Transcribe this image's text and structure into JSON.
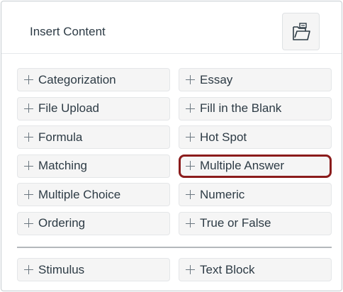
{
  "panel": {
    "title": "Insert Content",
    "folder_icon": "folder-open-icon"
  },
  "items": [
    {
      "label": "Categorization"
    },
    {
      "label": "Essay"
    },
    {
      "label": "File Upload"
    },
    {
      "label": "Fill in the Blank"
    },
    {
      "label": "Formula"
    },
    {
      "label": "Hot Spot"
    },
    {
      "label": "Matching"
    },
    {
      "label": "Multiple Answer",
      "highlighted": true
    },
    {
      "label": "Multiple Choice"
    },
    {
      "label": "Numeric"
    },
    {
      "label": "Ordering"
    },
    {
      "label": "True or False"
    }
  ],
  "extra_items": [
    {
      "label": "Stimulus"
    },
    {
      "label": "Text Block"
    }
  ],
  "colors": {
    "highlight_border": "#8b1c1c",
    "button_bg": "#f5f5f5",
    "text": "#2d3b45"
  }
}
